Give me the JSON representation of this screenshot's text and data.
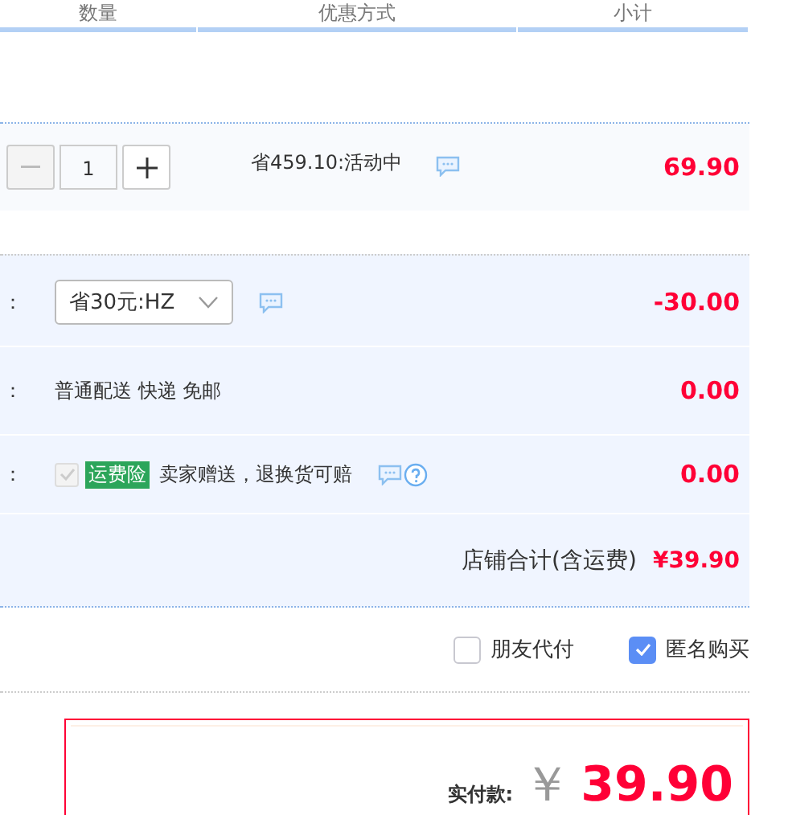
{
  "columns": [
    "数量",
    "优惠方式",
    "小计"
  ],
  "item": {
    "quantity": "1",
    "minus_disabled": true,
    "promo": "省459.10:活动中",
    "subtotal": "69.90"
  },
  "fees": [
    {
      "kind": "select",
      "label": "：",
      "value": "省30元:HZ",
      "amount": "-30.00"
    },
    {
      "kind": "text",
      "label": "：",
      "value": "普通配送 快递 免邮",
      "amount": "0.00"
    },
    {
      "kind": "insurance",
      "label": "：",
      "checked": true,
      "disabled": true,
      "tag": "运费险",
      "value": "卖家赠送，退换货可赔",
      "amount": "0.00"
    }
  ],
  "shop_total": {
    "label": "店铺合计(含运费)",
    "amount": "¥39.90"
  },
  "options": [
    {
      "label": "朋友代付",
      "checked": false
    },
    {
      "label": "匿名购买",
      "checked": true
    }
  ],
  "payment": {
    "label": "实付款:",
    "currency": "￥",
    "amount": "39.90"
  }
}
